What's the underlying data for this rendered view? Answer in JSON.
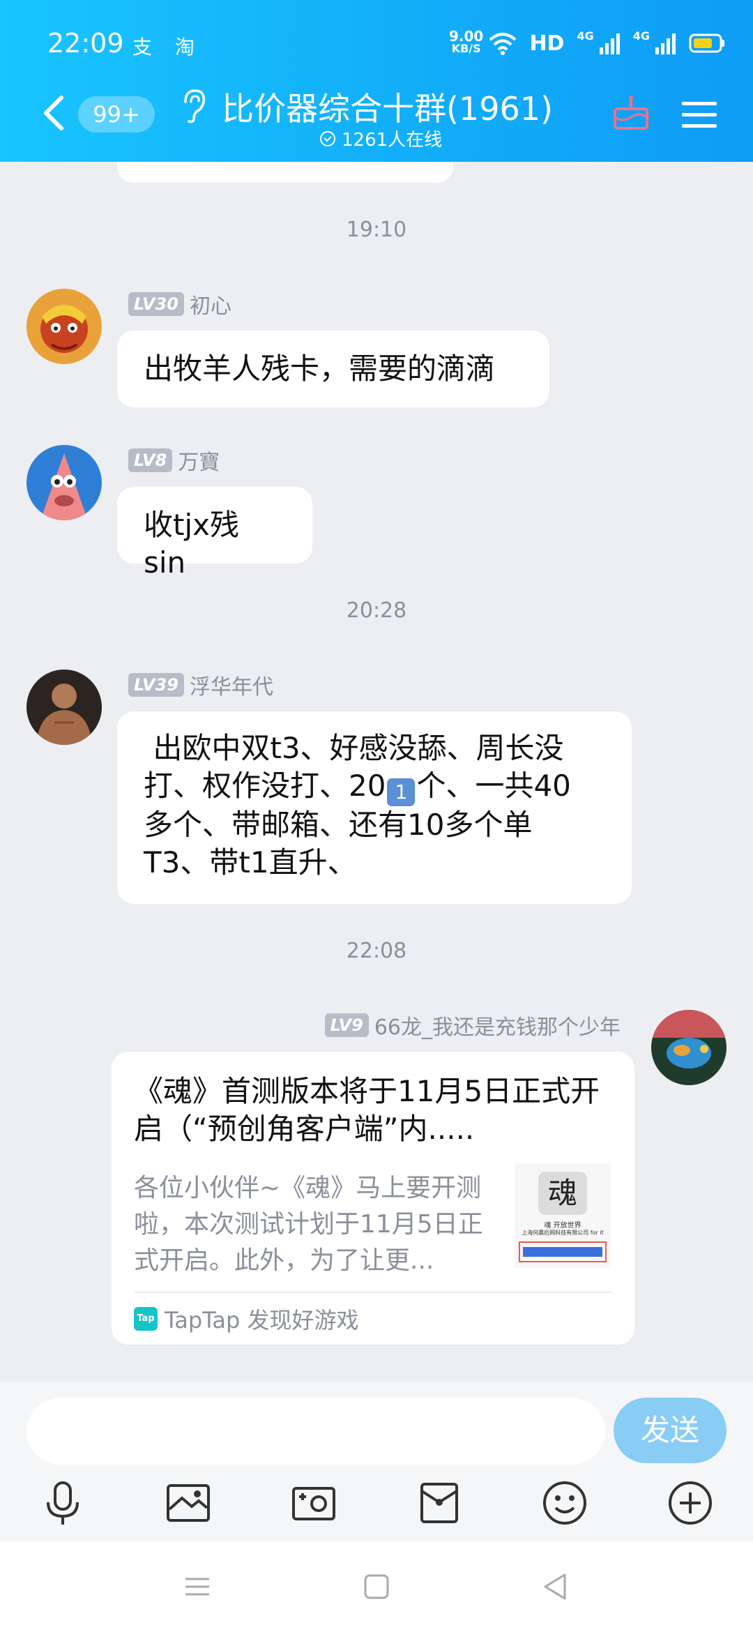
{
  "status_bar": {
    "time": "22:09",
    "apps": "支 淘",
    "speed_value": "9.00",
    "speed_unit": "KB/S",
    "hd": "HD",
    "net1": "4G",
    "net2": "4G"
  },
  "header": {
    "unread_badge": "99+",
    "title": "比价器综合十群(1961)",
    "online": "1261人在线"
  },
  "chat": {
    "timestamps": [
      "19:10",
      "20:28",
      "22:08"
    ],
    "messages": [
      {
        "level": "LV30",
        "name": "初心",
        "text": "出牧羊人残卡，需要的滴滴"
      },
      {
        "level": "LV8",
        "name": "万寶",
        "text": "收tjx残 sin"
      },
      {
        "level": "LV39",
        "name": "浮华年代",
        "lines": [
          " 出欧中双t3、好感没舔、周长没",
          "打、权作没打、20",
          "个、一共40",
          "多个、带邮箱、还有10多个单",
          "T3、带t1直升、"
        ],
        "emoji": "1"
      },
      {
        "level": "LV9",
        "name": "66龙_我还是充钱那个少年"
      }
    ],
    "card": {
      "title": "《魂》首测版本将于11月5日正式开启（“预创角客户端”内.....",
      "description": "各位小伙伴~《魂》马上要开测啦，本次测试计划于11月5日正式开启。此外，为了让更...",
      "thumb_char": "魂",
      "thumb_line1": "魂 开放世界",
      "thumb_line2": "上海何晨后网科技有限公司 for it",
      "source_logo": "Tap",
      "source": "TapTap 发现好游戏"
    }
  },
  "input": {
    "send_label": "发送",
    "placeholder": ""
  }
}
